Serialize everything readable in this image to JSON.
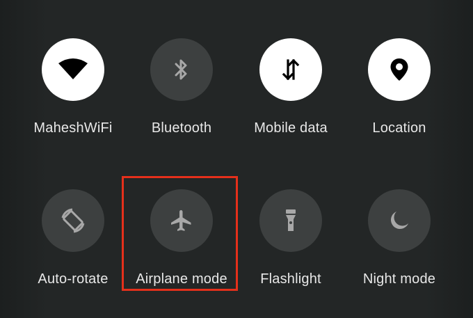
{
  "tiles": [
    {
      "label": "MaheshWiFi",
      "icon": "wifi-icon",
      "active": true
    },
    {
      "label": "Bluetooth",
      "icon": "bluetooth-icon",
      "active": false
    },
    {
      "label": "Mobile data",
      "icon": "mobile-data-icon",
      "active": true
    },
    {
      "label": "Location",
      "icon": "location-pin-icon",
      "active": true
    },
    {
      "label": "Auto-rotate",
      "icon": "auto-rotate-icon",
      "active": false
    },
    {
      "label": "Airplane mode",
      "icon": "airplane-icon",
      "active": false
    },
    {
      "label": "Flashlight",
      "icon": "flashlight-icon",
      "active": false
    },
    {
      "label": "Night mode",
      "icon": "moon-icon",
      "active": false
    }
  ],
  "colors": {
    "active_tile": "#ffffff",
    "inactive_tile": "#3d4040",
    "inactive_icon": "#a8a8a8",
    "highlight": "#e5301b"
  }
}
